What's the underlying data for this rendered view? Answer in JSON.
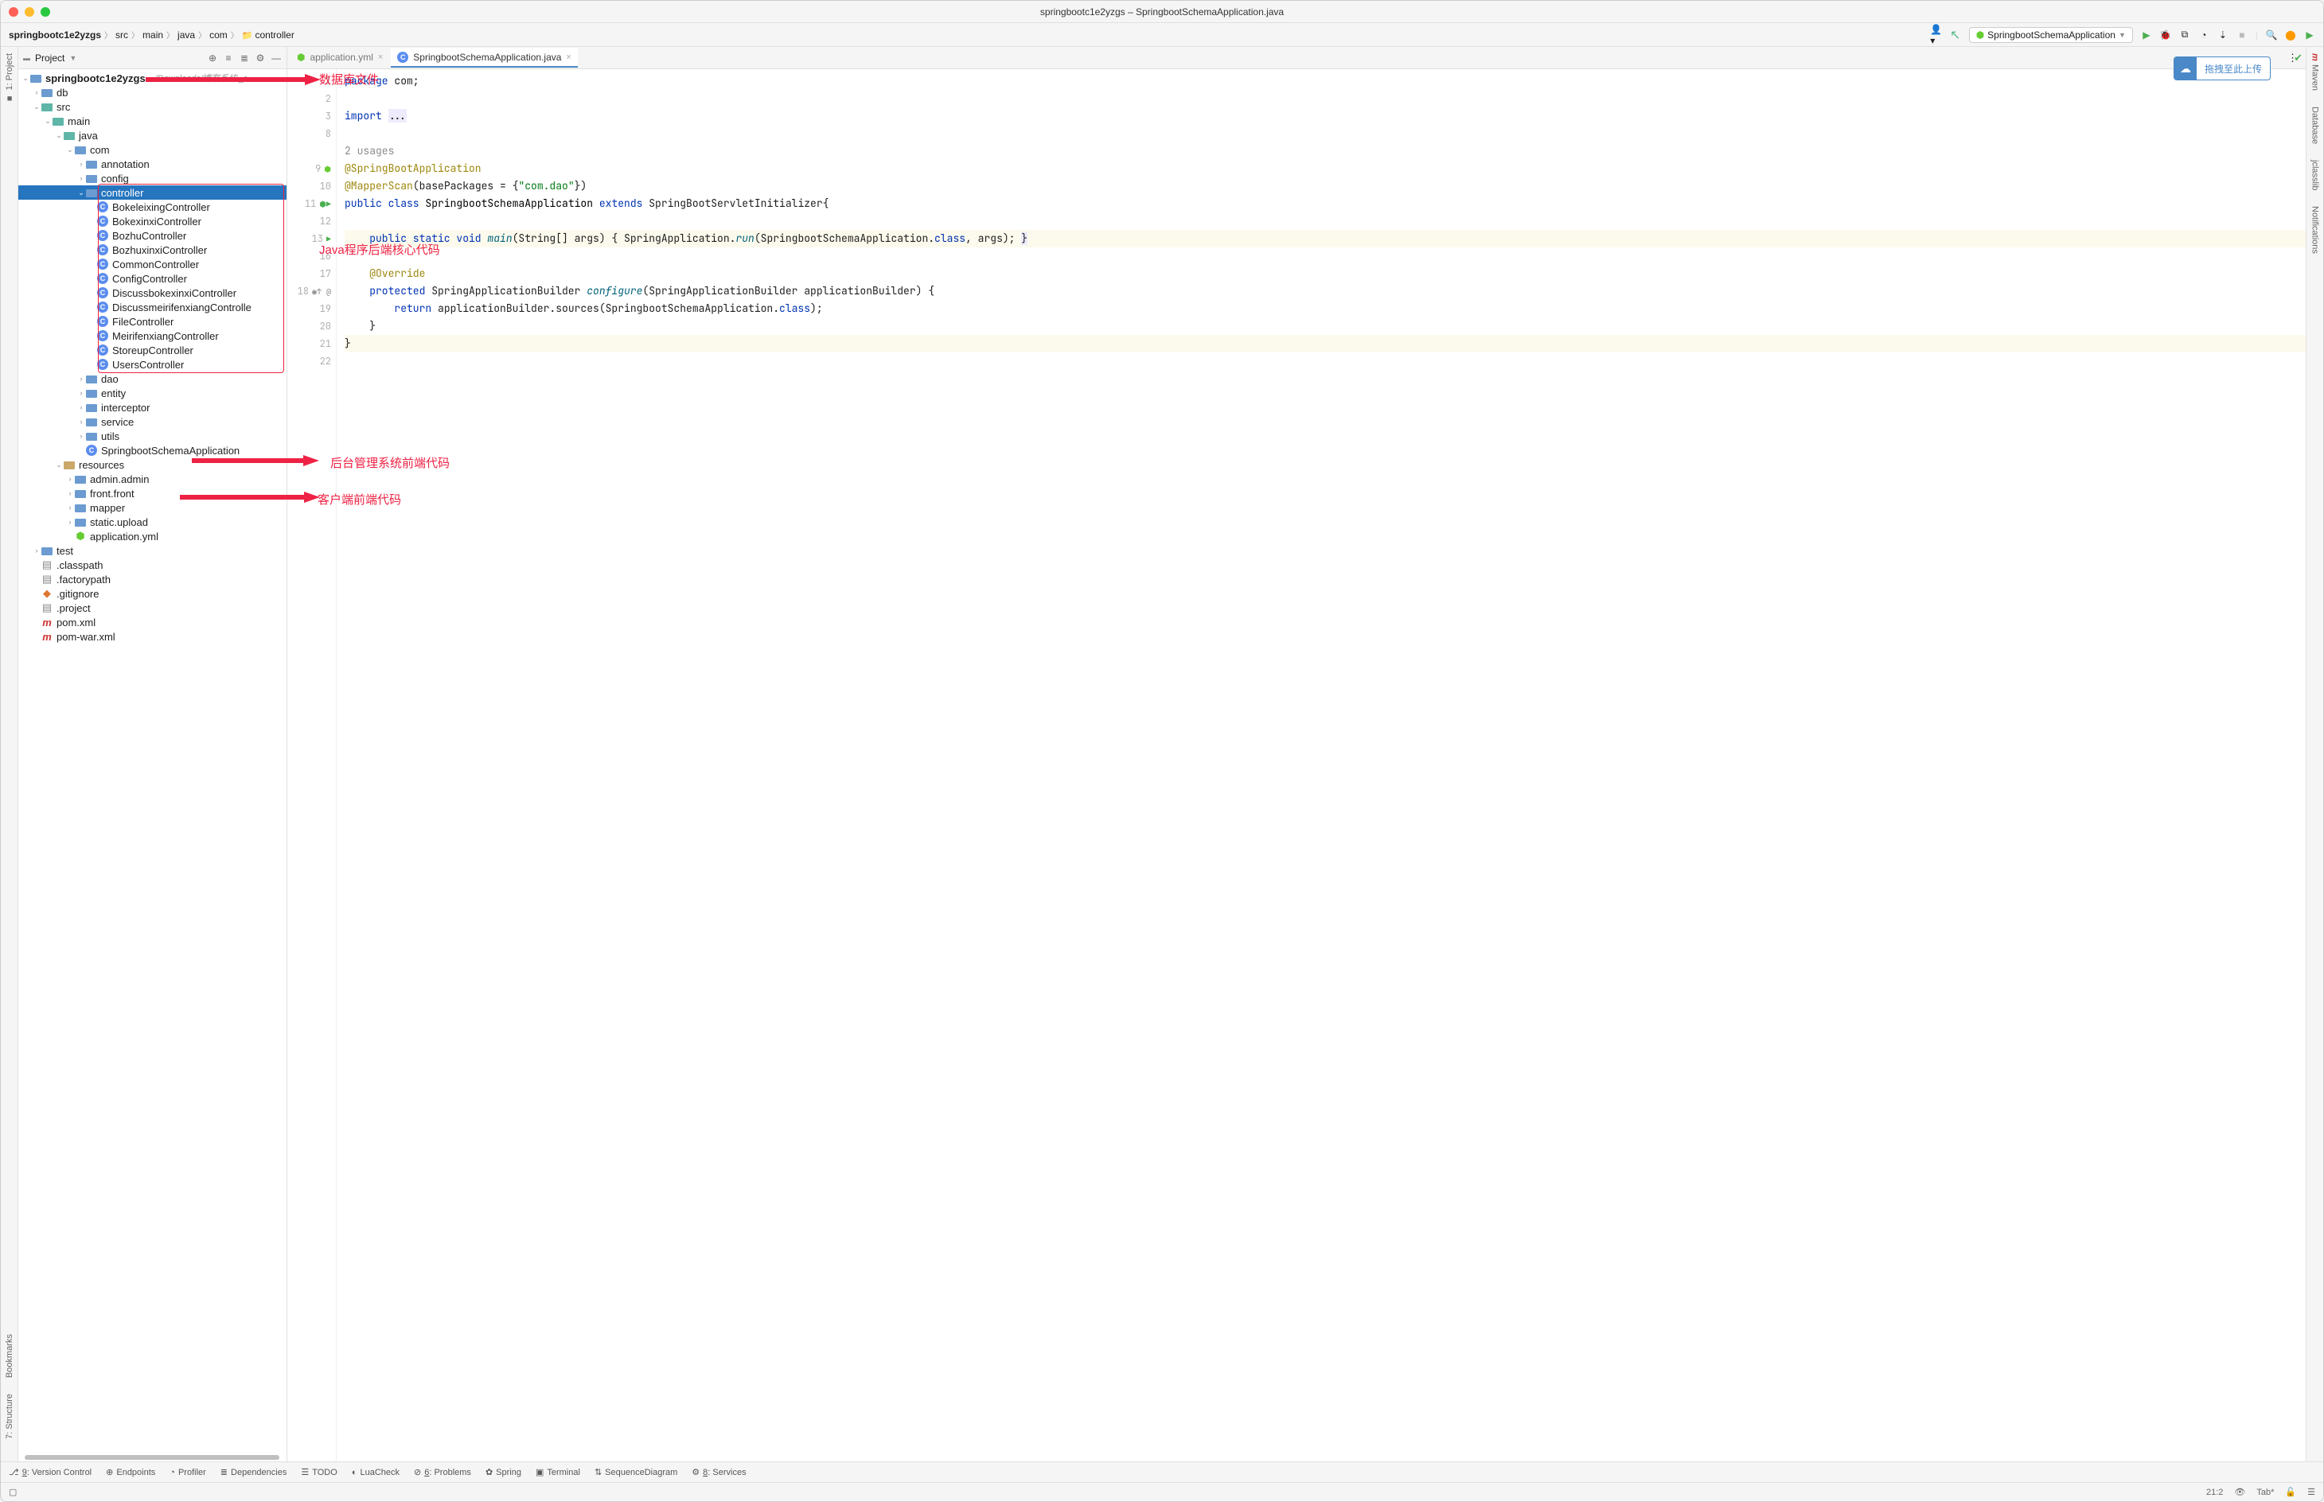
{
  "window_title": "springbootc1e2yzgs – SpringbootSchemaApplication.java",
  "traffic_lights": [
    "close",
    "minimize",
    "zoom"
  ],
  "breadcrumbs": [
    "springbootc1e2yzgs",
    "src",
    "main",
    "java",
    "com",
    "controller"
  ],
  "run_config": "SpringbootSchemaApplication",
  "left_gutter": [
    "1: Project"
  ],
  "left_gutter_bottom": [
    "Bookmarks",
    "7: Structure"
  ],
  "right_gutter": [
    "Maven",
    "Database",
    "jclasslib",
    "Notifications"
  ],
  "project_panel": {
    "label": "Project",
    "header_icons": [
      "target",
      "collapse",
      "expand",
      "settings",
      "hide"
    ]
  },
  "tree": [
    {
      "d": 0,
      "exp": "v",
      "ic": "proj",
      "t": "springbootc1e2yzgs",
      "sub": "~/Downloads/博客系统_c"
    },
    {
      "d": 1,
      "exp": ">",
      "ic": "folder",
      "t": "db"
    },
    {
      "d": 1,
      "exp": "v",
      "ic": "folder-teal",
      "t": "src"
    },
    {
      "d": 2,
      "exp": "v",
      "ic": "folder-teal",
      "t": "main"
    },
    {
      "d": 3,
      "exp": "v",
      "ic": "folder-teal",
      "t": "java"
    },
    {
      "d": 4,
      "exp": "v",
      "ic": "pkg",
      "t": "com"
    },
    {
      "d": 5,
      "exp": ">",
      "ic": "pkg",
      "t": "annotation"
    },
    {
      "d": 5,
      "exp": ">",
      "ic": "pkg",
      "t": "config"
    },
    {
      "d": 5,
      "exp": "v",
      "ic": "pkg",
      "t": "controller",
      "sel": true
    },
    {
      "d": 6,
      "ic": "class",
      "t": "BokeleixingController"
    },
    {
      "d": 6,
      "ic": "class",
      "t": "BokexinxiController"
    },
    {
      "d": 6,
      "ic": "class",
      "t": "BozhuController"
    },
    {
      "d": 6,
      "ic": "class",
      "t": "BozhuxinxiController"
    },
    {
      "d": 6,
      "ic": "class",
      "t": "CommonController"
    },
    {
      "d": 6,
      "ic": "class",
      "t": "ConfigController"
    },
    {
      "d": 6,
      "ic": "class",
      "t": "DiscussbokexinxiController"
    },
    {
      "d": 6,
      "ic": "class",
      "t": "DiscussmeirifenxiangControlle"
    },
    {
      "d": 6,
      "ic": "class",
      "t": "FileController"
    },
    {
      "d": 6,
      "ic": "class",
      "t": "MeirifenxiangController"
    },
    {
      "d": 6,
      "ic": "class",
      "t": "StoreupController"
    },
    {
      "d": 6,
      "ic": "class",
      "t": "UsersController"
    },
    {
      "d": 5,
      "exp": ">",
      "ic": "pkg",
      "t": "dao"
    },
    {
      "d": 5,
      "exp": ">",
      "ic": "pkg",
      "t": "entity"
    },
    {
      "d": 5,
      "exp": ">",
      "ic": "pkg",
      "t": "interceptor"
    },
    {
      "d": 5,
      "exp": ">",
      "ic": "pkg",
      "t": "service"
    },
    {
      "d": 5,
      "exp": ">",
      "ic": "pkg",
      "t": "utils"
    },
    {
      "d": 5,
      "ic": "class",
      "t": "SpringbootSchemaApplication"
    },
    {
      "d": 3,
      "exp": "v",
      "ic": "res",
      "t": "resources"
    },
    {
      "d": 4,
      "exp": ">",
      "ic": "folder",
      "t": "admin.admin"
    },
    {
      "d": 4,
      "exp": ">",
      "ic": "folder",
      "t": "front.front"
    },
    {
      "d": 4,
      "exp": ">",
      "ic": "folder",
      "t": "mapper"
    },
    {
      "d": 4,
      "exp": ">",
      "ic": "folder",
      "t": "static.upload"
    },
    {
      "d": 4,
      "ic": "yml",
      "t": "application.yml"
    },
    {
      "d": 1,
      "exp": ">",
      "ic": "folder",
      "t": "test"
    },
    {
      "d": 1,
      "ic": "file",
      "t": ".classpath"
    },
    {
      "d": 1,
      "ic": "file",
      "t": ".factorypath"
    },
    {
      "d": 1,
      "ic": "git",
      "t": ".gitignore"
    },
    {
      "d": 1,
      "ic": "file",
      "t": ".project"
    },
    {
      "d": 1,
      "ic": "mvn",
      "t": "pom.xml"
    },
    {
      "d": 1,
      "ic": "mvn",
      "t": "pom-war.xml"
    }
  ],
  "tabs": [
    {
      "label": "application.yml",
      "active": false,
      "icon": "yml"
    },
    {
      "label": "SpringbootSchemaApplication.java",
      "active": true,
      "icon": "class"
    }
  ],
  "upload_label": "拖拽至此上传",
  "annotations": {
    "db": "数据库文件",
    "java": "Java程序后端核心代码",
    "admin": "后台管理系统前端代码",
    "front": "客户端前端代码"
  },
  "code_lines": [
    {
      "n": 1,
      "html": "<span class='kw'>package</span> com;"
    },
    {
      "n": 2,
      "html": ""
    },
    {
      "n": 3,
      "html": "<span class='kw'>import</span> <span class='hl'>...</span>"
    },
    {
      "n": 8,
      "html": ""
    },
    {
      "n": "",
      "html": "<span class='cmt'>2 usages</span>"
    },
    {
      "n": 9,
      "gi": "sb",
      "html": "<span class='ann'>@SpringBootApplication</span>"
    },
    {
      "n": 10,
      "html": "<span class='ann'>@MapperScan</span>(basePackages = {<span class='str'>\"com.dao\"</span>})"
    },
    {
      "n": 11,
      "gi": "run",
      "html": "<span class='kw'>public class</span> <span class='cls'>SpringbootSchemaApplication</span> <span class='kw'>extends</span> SpringBootServletInitializer{"
    },
    {
      "n": 12,
      "html": ""
    },
    {
      "n": 13,
      "gi": "play",
      "cls": "main-line",
      "html": "    <span class='kw'>public static void</span> <span class='fn'>main</span>(String[] args) { SpringApplication.<span class='fn'>run</span>(SpringbootSchemaApplication.<span class='kw'>class</span>, args); <span class='hl'>}</span>"
    },
    {
      "n": 16,
      "html": ""
    },
    {
      "n": 17,
      "html": "    <span class='ann'>@Override</span>"
    },
    {
      "n": 18,
      "gi": "ovr",
      "html": "    <span class='kw'>protected</span> SpringApplicationBuilder <span class='fn'>configure</span>(SpringApplicationBuilder applicationBuilder) {"
    },
    {
      "n": 19,
      "html": "        <span class='kw'>return</span> applicationBuilder.sources(SpringbootSchemaApplication.<span class='kw'>class</span>);"
    },
    {
      "n": 20,
      "html": "    }"
    },
    {
      "n": 21,
      "cls": "caret-line",
      "html": "}"
    },
    {
      "n": 22,
      "html": ""
    }
  ],
  "bottom_tools": [
    {
      "icon": "vcs",
      "label": "9: Version Control",
      "u": "9"
    },
    {
      "icon": "ep",
      "label": "Endpoints"
    },
    {
      "icon": "prof",
      "label": "Profiler"
    },
    {
      "icon": "dep",
      "label": "Dependencies"
    },
    {
      "icon": "todo",
      "label": "TODO"
    },
    {
      "icon": "lua",
      "label": "LuaCheck"
    },
    {
      "icon": "prob",
      "label": "6: Problems",
      "u": "6"
    },
    {
      "icon": "spring",
      "label": "Spring"
    },
    {
      "icon": "term",
      "label": "Terminal"
    },
    {
      "icon": "seq",
      "label": "SequenceDiagram"
    },
    {
      "icon": "svc",
      "label": "8: Services",
      "u": "8"
    }
  ],
  "status": {
    "pos": "21:2",
    "indent": "Tab*",
    "lock": "🔒",
    "other": "👁"
  }
}
